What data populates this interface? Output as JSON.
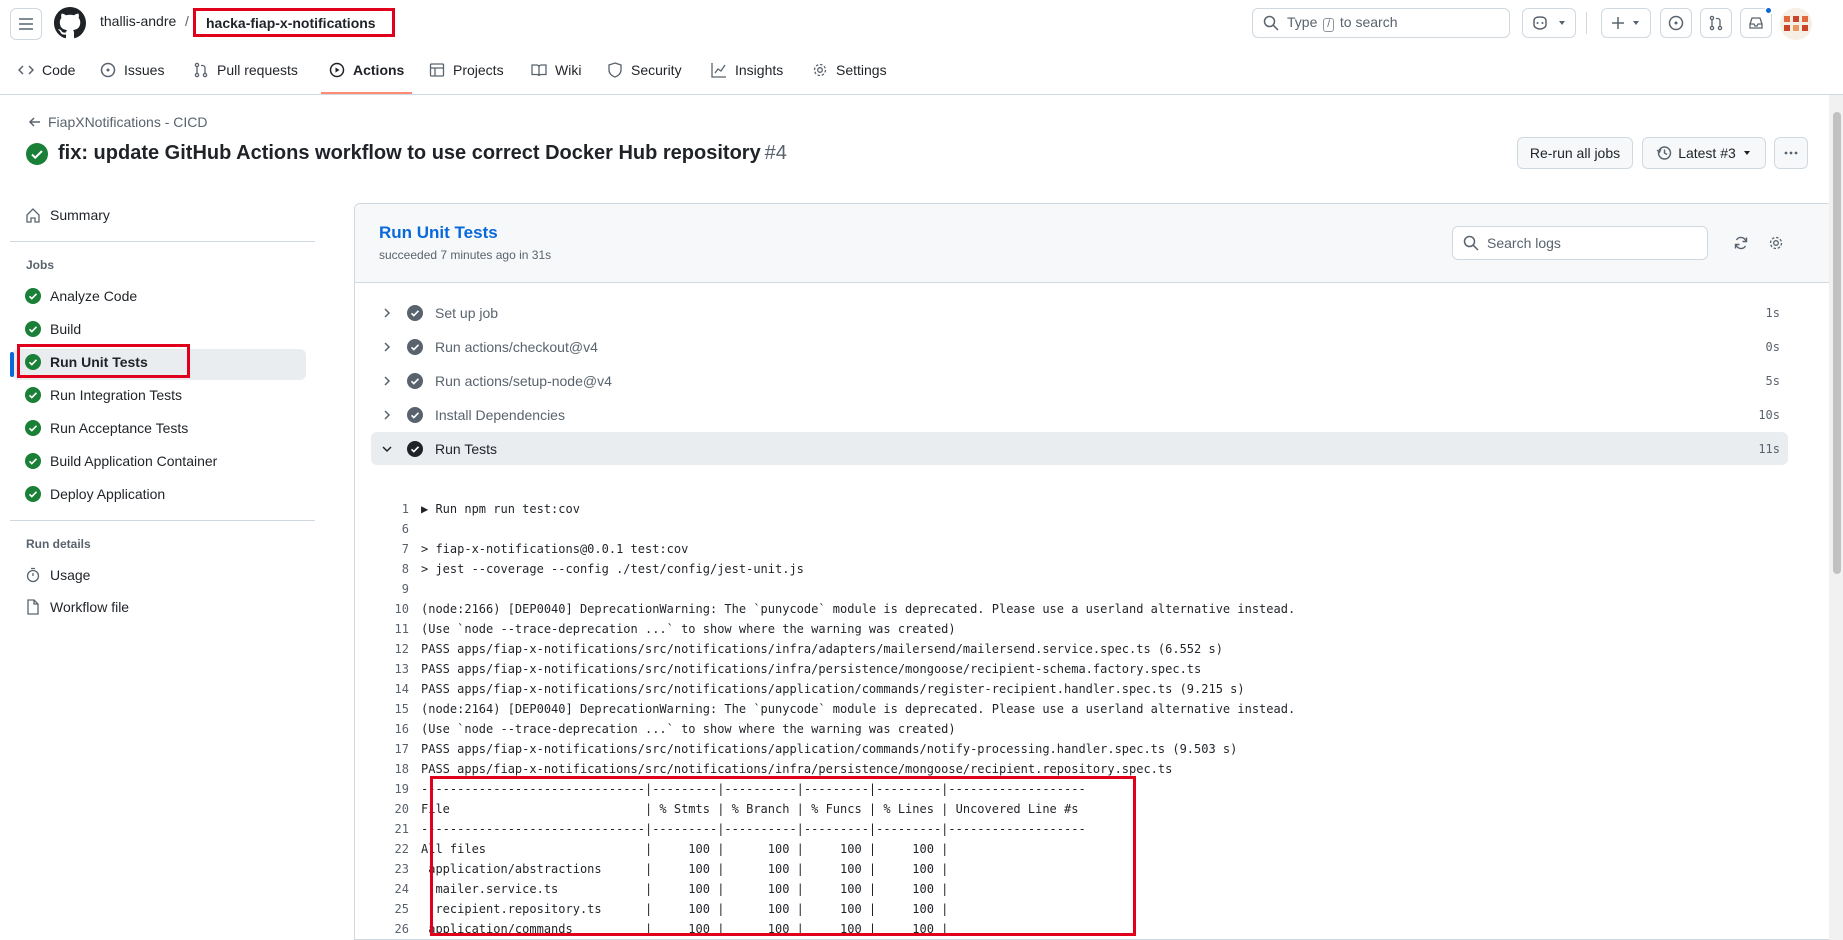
{
  "header": {
    "owner": "thallis-andre",
    "separator": "/",
    "repo": "hacka-fiap-x-notifications",
    "search_text_before": "Type",
    "search_key": "/",
    "search_text_after": "to search"
  },
  "repo_nav": {
    "items": [
      {
        "label": "Code",
        "icon": "code-icon"
      },
      {
        "label": "Issues",
        "icon": "issue-opened-icon"
      },
      {
        "label": "Pull requests",
        "icon": "git-pull-request-icon"
      },
      {
        "label": "Actions",
        "icon": "play-icon"
      },
      {
        "label": "Projects",
        "icon": "table-icon"
      },
      {
        "label": "Wiki",
        "icon": "book-icon"
      },
      {
        "label": "Security",
        "icon": "shield-icon"
      },
      {
        "label": "Insights",
        "icon": "graph-icon"
      },
      {
        "label": "Settings",
        "icon": "gear-icon"
      }
    ],
    "active": "Actions"
  },
  "run": {
    "workflow_link": "FiapXNotifications - CICD",
    "title": "fix: update GitHub Actions workflow to use correct Docker Hub repository",
    "number": "#4",
    "rerun_label": "Re-run all jobs",
    "attempt_label": "Latest #3"
  },
  "sidebar": {
    "summary": "Summary",
    "jobs_heading": "Jobs",
    "jobs": [
      "Analyze Code",
      "Build",
      "Run Unit Tests",
      "Run Integration Tests",
      "Run Acceptance Tests",
      "Build Application Container",
      "Deploy Application"
    ],
    "active_job": "Run Unit Tests",
    "run_details_heading": "Run details",
    "usage": "Usage",
    "workflow_file": "Workflow file"
  },
  "job": {
    "name": "Run Unit Tests",
    "meta": "succeeded 7 minutes ago in 31s",
    "search_placeholder": "Search logs",
    "steps": [
      {
        "name": "Set up job",
        "duration": "1s",
        "expanded": false
      },
      {
        "name": "Run actions/checkout@v4",
        "duration": "0s",
        "expanded": false
      },
      {
        "name": "Run actions/setup-node@v4",
        "duration": "5s",
        "expanded": false
      },
      {
        "name": "Install Dependencies",
        "duration": "10s",
        "expanded": false
      },
      {
        "name": "Run Tests",
        "duration": "11s",
        "expanded": true
      }
    ],
    "log_lines": [
      {
        "n": "1",
        "t": "▶ Run npm run test:cov"
      },
      {
        "n": "6",
        "t": ""
      },
      {
        "n": "7",
        "t": "> fiap-x-notifications@0.0.1 test:cov"
      },
      {
        "n": "8",
        "t": "> jest --coverage --config ./test/config/jest-unit.js"
      },
      {
        "n": "9",
        "t": ""
      },
      {
        "n": "10",
        "t": "(node:2166) [DEP0040] DeprecationWarning: The `punycode` module is deprecated. Please use a userland alternative instead."
      },
      {
        "n": "11",
        "t": "(Use `node --trace-deprecation ...` to show where the warning was created)"
      },
      {
        "n": "12",
        "t": "PASS apps/fiap-x-notifications/src/notifications/infra/adapters/mailersend/mailersend.service.spec.ts (6.552 s)"
      },
      {
        "n": "13",
        "t": "PASS apps/fiap-x-notifications/src/notifications/infra/persistence/mongoose/recipient-schema.factory.spec.ts"
      },
      {
        "n": "14",
        "t": "PASS apps/fiap-x-notifications/src/notifications/application/commands/register-recipient.handler.spec.ts (9.215 s)"
      },
      {
        "n": "15",
        "t": "(node:2164) [DEP0040] DeprecationWarning: The `punycode` module is deprecated. Please use a userland alternative instead."
      },
      {
        "n": "16",
        "t": "(Use `node --trace-deprecation ...` to show where the warning was created)"
      },
      {
        "n": "17",
        "t": "PASS apps/fiap-x-notifications/src/notifications/application/commands/notify-processing.handler.spec.ts (9.503 s)"
      },
      {
        "n": "18",
        "t": "PASS apps/fiap-x-notifications/src/notifications/infra/persistence/mongoose/recipient.repository.spec.ts"
      },
      {
        "n": "19",
        "t": "-------------------------------|---------|----------|---------|---------|-------------------"
      },
      {
        "n": "20",
        "t": "File                           | % Stmts | % Branch | % Funcs | % Lines | Uncovered Line #s"
      },
      {
        "n": "21",
        "t": "-------------------------------|---------|----------|---------|---------|-------------------"
      },
      {
        "n": "22",
        "t": "All files                      |     100 |      100 |     100 |     100 |"
      },
      {
        "n": "23",
        "t": " application/abstractions      |     100 |      100 |     100 |     100 |"
      },
      {
        "n": "24",
        "t": "  mailer.service.ts            |     100 |      100 |     100 |     100 |"
      },
      {
        "n": "25",
        "t": "  recipient.repository.ts      |     100 |      100 |     100 |     100 |"
      },
      {
        "n": "26",
        "t": " application/commands          |     100 |      100 |     100 |     100 |"
      }
    ]
  },
  "colors": {
    "success": "#1a7f37",
    "link": "#0969da",
    "highlight": "#e0001b",
    "active_tab_underline": "#fd8c73"
  }
}
